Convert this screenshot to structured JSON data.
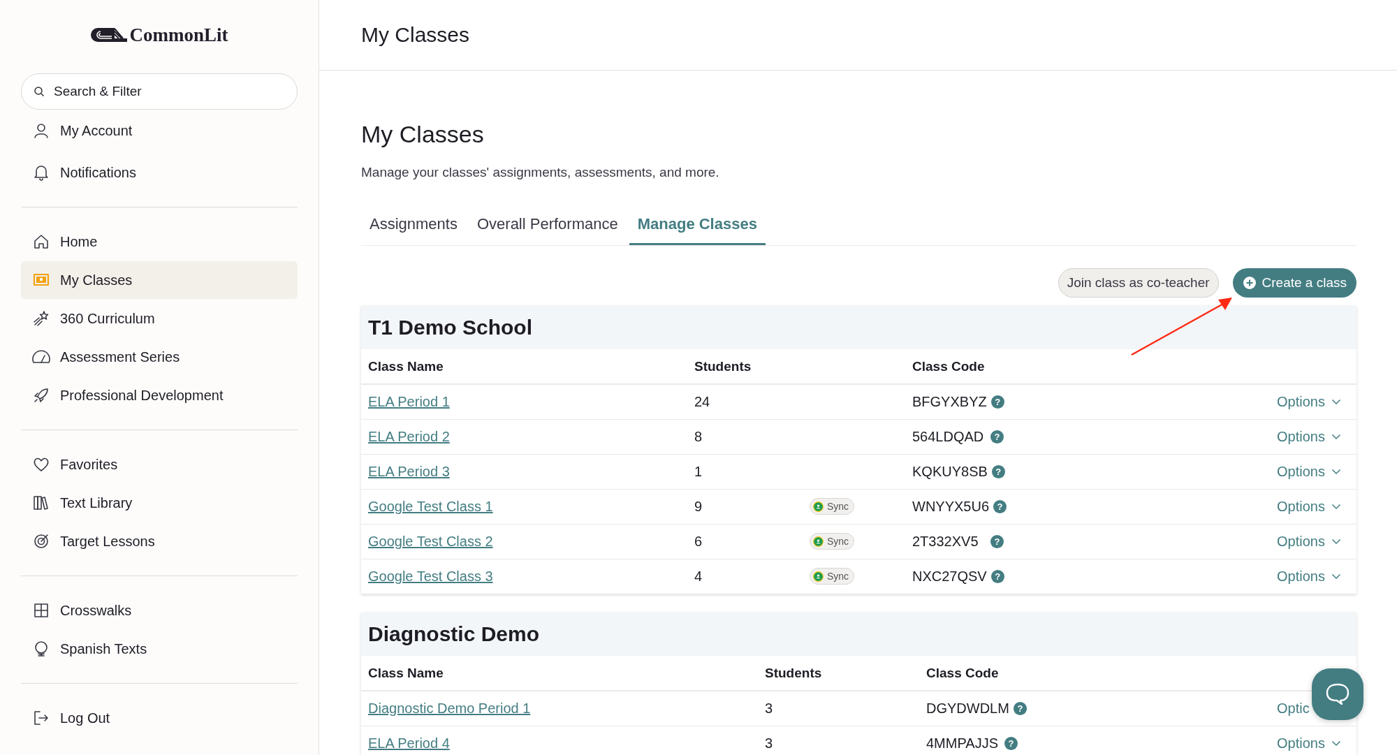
{
  "sidebar": {
    "logo": "CommonLit",
    "search": {
      "placeholder": "Search & Filter"
    },
    "sections": [
      [
        {
          "label": "My Account",
          "selected": false
        },
        {
          "label": "Notifications",
          "selected": false
        }
      ],
      [
        {
          "label": "Home",
          "selected": false
        },
        {
          "label": "My Classes",
          "selected": true
        },
        {
          "label": "360 Curriculum",
          "selected": false
        },
        {
          "label": "Assessment Series",
          "selected": false
        },
        {
          "label": "Professional Development",
          "selected": false
        }
      ],
      [
        {
          "label": "Favorites",
          "selected": false
        },
        {
          "label": "Text Library",
          "selected": false
        },
        {
          "label": "Target Lessons",
          "selected": false
        }
      ],
      [
        {
          "label": "Crosswalks",
          "selected": false
        },
        {
          "label": "Spanish Texts",
          "selected": false
        }
      ],
      [
        {
          "label": "Log Out",
          "selected": false
        }
      ]
    ]
  },
  "header": {
    "title": "My Classes"
  },
  "page": {
    "title": "My Classes",
    "subtitle": "Manage your classes' assignments, assessments, and more.",
    "tabs": [
      {
        "label": "Assignments",
        "selected": false
      },
      {
        "label": "Overall Performance",
        "selected": false
      },
      {
        "label": "Manage Classes",
        "selected": true
      }
    ],
    "actions": {
      "join": "Join class as co-teacher",
      "create": "Create a class"
    },
    "schools": [
      {
        "name": "T1 Demo School",
        "columns": [
          "Class Name",
          "Students",
          "Class Code"
        ],
        "rows": [
          {
            "name": "ELA Period 1",
            "students": "24",
            "code": "BFGYXBYZ",
            "help": "?",
            "options": "Options",
            "chevron": true
          },
          {
            "name": "ELA Period 2",
            "students": "8",
            "code": "564LDQAD",
            "help": "?",
            "options": "Options",
            "chevron": true
          },
          {
            "name": "ELA Period 3",
            "students": "1",
            "code": "KQKUY8SB",
            "help": "?",
            "options": "Options",
            "chevron": true
          },
          {
            "name": "Google Test Class 1",
            "students": "9",
            "sync": "Sync",
            "code": "WNYYX5U6",
            "help": "?",
            "options": "Options",
            "chevron": true
          },
          {
            "name": "Google Test Class 2",
            "students": "6",
            "sync": "Sync",
            "code": "2T332XV5",
            "help": "?",
            "options": "Options",
            "chevron": true
          },
          {
            "name": "Google Test Class 3",
            "students": "4",
            "sync": "Sync",
            "code": "NXC27QSV",
            "help": "?",
            "options": "Options",
            "chevron": true
          }
        ]
      },
      {
        "name": "Diagnostic Demo",
        "columns": [
          "Class Name",
          "Students",
          "Class Code"
        ],
        "rows": [
          {
            "name": "Diagnostic Demo Period 1",
            "students": "3",
            "code": "DGYDWDLM",
            "help": "?",
            "options": "Optic",
            "chevron": false
          },
          {
            "name": "ELA Period 4",
            "students": "3",
            "code": "4MMPAJJS",
            "help": "?",
            "options": "Options",
            "chevron": true
          }
        ]
      }
    ]
  }
}
